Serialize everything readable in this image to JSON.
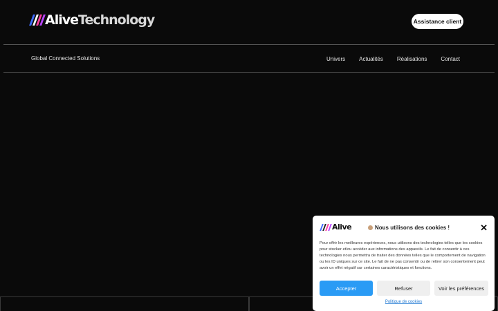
{
  "header": {
    "logo_alive": "Alive",
    "logo_technology": "Technology",
    "stripe_colors": [
      "#3f6bff",
      "#ffffff",
      "#ff3fa0",
      "#b845ff"
    ],
    "support_label": "Assistance client",
    "tagline": "Global Connected Solutions"
  },
  "nav": {
    "items": [
      "Univers",
      "Actualités",
      "Réalisations",
      "Contact"
    ]
  },
  "cookie_banner": {
    "logo_text": "Alive",
    "title": "Nous utilisons des cookies !",
    "close_icon": "close-icon",
    "body": "Pour offrir les meilleures expériences, nous utilisons des technologies telles que les cookies pour stocker et/ou accéder aux informations des appareils. Le fait de consentir à ces technologies nous permettra de traiter des données telles que le comportement de navigation ou les ID uniques sur ce site. Le fait de ne pas consentir ou de retirer son consentement peut avoir un effet négatif sur certaines caractéristiques et fonctions.",
    "accept_label": "Accepter",
    "refuse_label": "Refuser",
    "prefs_label": "Voir les préférences",
    "policy_label": "Politique de cookies",
    "accent_color": "#2a9bf5"
  },
  "colors": {
    "background": "#0a0a0a",
    "text": "#ffffff"
  }
}
